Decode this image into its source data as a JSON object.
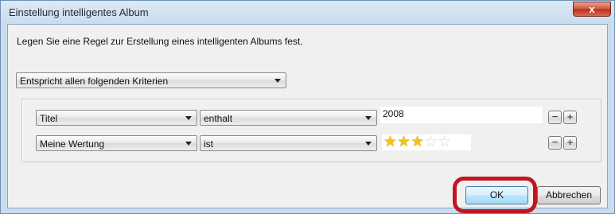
{
  "window": {
    "title": "Einstellung intelligentes Album",
    "close_label": "x"
  },
  "description": "Legen Sie eine Regel zur Erstellung eines intelligenten Albums fest.",
  "match_select": {
    "value": "Entspricht allen folgenden Kriterien"
  },
  "rules": [
    {
      "field": "Titel",
      "operator": "enthalt",
      "value": "2008",
      "minus": "−",
      "plus": "+"
    },
    {
      "field": "Meine Wertung",
      "operator": "ist",
      "rating": 3,
      "rating_max": 5,
      "minus": "−",
      "plus": "+"
    }
  ],
  "buttons": {
    "ok": "OK",
    "cancel": "Abbrechen"
  },
  "colors": {
    "highlight": "#c0161f",
    "star_on": "#f3c414",
    "star_off": "#d7d7d7"
  }
}
